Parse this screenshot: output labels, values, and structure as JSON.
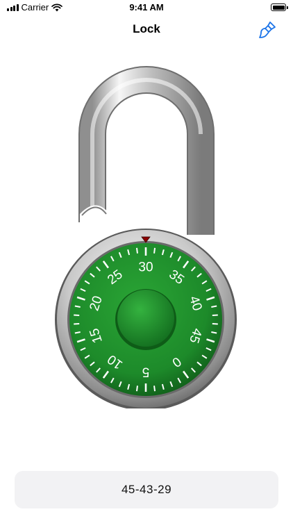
{
  "status_bar": {
    "carrier": "Carrier",
    "time": "9:41 AM",
    "icons": [
      "signal-icon",
      "wifi-icon",
      "battery-icon"
    ]
  },
  "nav": {
    "title": "Lock",
    "right_button_icon": "paintbrush-icon",
    "accent_color": "#1a73e8"
  },
  "lock": {
    "dial_color": "#1d8a2a",
    "dial_numbers": [
      "0",
      "5",
      "10",
      "15",
      "20",
      "25",
      "30",
      "35",
      "40",
      "45"
    ],
    "top_number": "30",
    "indicator_color": "#8b0000"
  },
  "combination": {
    "value": "45-43-29"
  }
}
